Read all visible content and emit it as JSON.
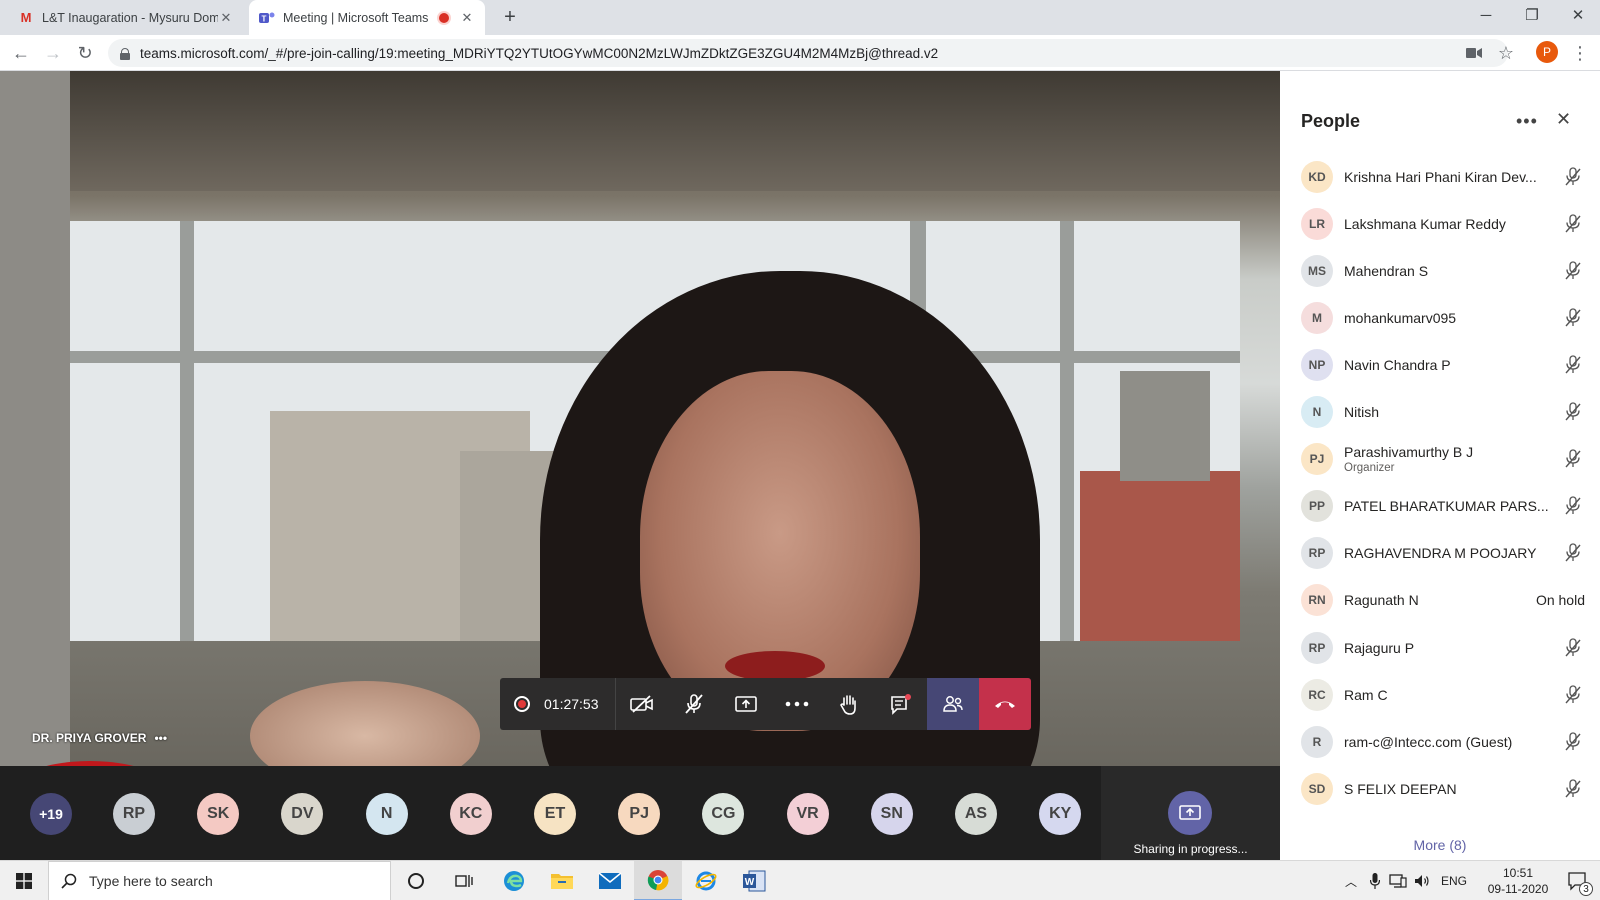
{
  "browser": {
    "tabs": [
      {
        "title": "L&T Inaugaration - Mysuru Dom",
        "icon": "gmail-icon"
      },
      {
        "title": "Meeting | Microsoft Teams",
        "icon": "teams-icon",
        "recording": true
      }
    ],
    "url": "teams.microsoft.com/_#/pre-join-calling/19:meeting_MDRiYTQ2YTUtOGYwMC00N2MzLWJmZDktZGE3ZGU4M2M4MzBj@thread.v2",
    "profile_initial": "P"
  },
  "meeting": {
    "speaker_name": "DR. PRIYA GROVER",
    "speaker_more": "•••",
    "timer": "01:27:53",
    "strip": {
      "overflow": "+19",
      "avatars": [
        {
          "initials": "RP",
          "color": "#c9ced3"
        },
        {
          "initials": "SK",
          "color": "#f4c9c3"
        },
        {
          "initials": "DV",
          "color": "#d9d6cc"
        },
        {
          "initials": "N",
          "color": "#d4e6f0"
        },
        {
          "initials": "KC",
          "color": "#f1cfcf"
        },
        {
          "initials": "ET",
          "color": "#f6e3c3"
        },
        {
          "initials": "PJ",
          "color": "#f7d9bf"
        },
        {
          "initials": "CG",
          "color": "#dde6de"
        },
        {
          "initials": "VR",
          "color": "#f3cfd6"
        },
        {
          "initials": "SN",
          "color": "#d6d5ec"
        },
        {
          "initials": "AS",
          "color": "#d7dcd6"
        },
        {
          "initials": "KY",
          "color": "#d5d8ef"
        }
      ],
      "sharing_label": "Sharing in progress..."
    }
  },
  "people": {
    "title": "People",
    "more_label": "More (8)",
    "participants": [
      {
        "initials": "KD",
        "name": "Krishna Hari Phani Kiran Dev...",
        "color": "#fbe6c6",
        "status": "muted"
      },
      {
        "initials": "LR",
        "name": "Lakshmana Kumar Reddy",
        "color": "#fadbd8",
        "status": "muted"
      },
      {
        "initials": "MS",
        "name": "Mahendran S",
        "color": "#e1e4e8",
        "status": "muted"
      },
      {
        "initials": "M",
        "name": "mohankumarv095",
        "color": "#f5dddd",
        "status": "muted"
      },
      {
        "initials": "NP",
        "name": "Navin Chandra P",
        "color": "#dfe0f0",
        "status": "muted"
      },
      {
        "initials": "N",
        "name": "Nitish",
        "color": "#d8ecf4",
        "status": "muted"
      },
      {
        "initials": "PJ",
        "name": "Parashivamurthy B J",
        "sub": "Organizer",
        "color": "#fbe6c6",
        "status": "muted"
      },
      {
        "initials": "PP",
        "name": "PATEL BHARATKUMAR PARS...",
        "color": "#e2e2dc",
        "status": "muted"
      },
      {
        "initials": "RP",
        "name": "RAGHAVENDRA M POOJARY",
        "color": "#e1e4e8",
        "status": "muted"
      },
      {
        "initials": "RN",
        "name": "Ragunath N",
        "color": "#fbe2d6",
        "status": "hold",
        "status_text": "On hold"
      },
      {
        "initials": "RP",
        "name": "Rajaguru P",
        "color": "#e1e4e8",
        "status": "muted"
      },
      {
        "initials": "RC",
        "name": "Ram C",
        "color": "#ecebe4",
        "status": "muted"
      },
      {
        "initials": "R",
        "name": "ram-c@Intecc.com (Guest)",
        "color": "#e1e4e8",
        "status": "muted"
      },
      {
        "initials": "SD",
        "name": "S FELIX DEEPAN",
        "color": "#fbe6c6",
        "status": "muted"
      }
    ]
  },
  "taskbar": {
    "search_placeholder": "Type here to search",
    "lang": "ENG",
    "time": "10:51",
    "date": "09-11-2020",
    "notification_count": "3"
  }
}
